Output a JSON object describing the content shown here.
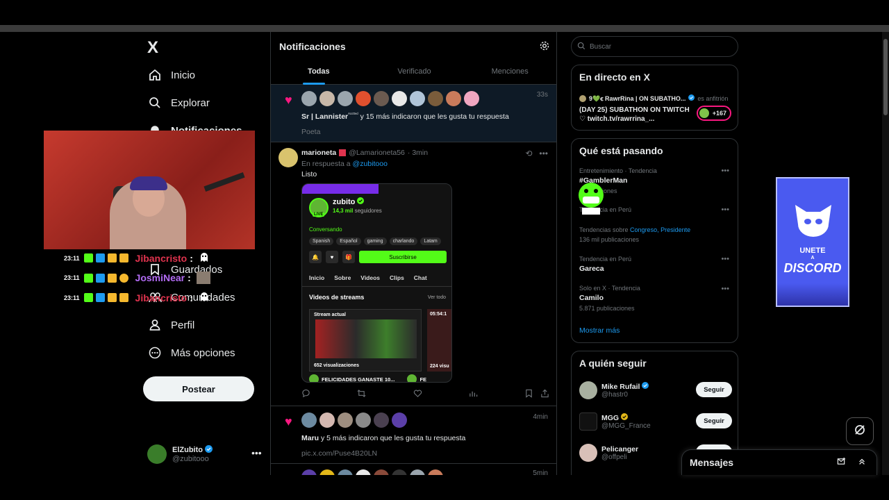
{
  "nav": {
    "logo": "X",
    "items": [
      {
        "label": "Inicio",
        "icon": "home-icon"
      },
      {
        "label": "Explorar",
        "icon": "search-icon"
      },
      {
        "label": "Notificaciones",
        "icon": "bell-icon"
      },
      {
        "label": "Guardados",
        "icon": "bookmark-icon"
      },
      {
        "label": "Comunidades",
        "icon": "people-icon"
      },
      {
        "label": "Perfil",
        "icon": "person-icon"
      },
      {
        "label": "Más opciones",
        "icon": "more-circle-icon"
      }
    ],
    "post_button": "Postear",
    "account": {
      "name": "ElZubito",
      "handle": "@zubitooo"
    }
  },
  "stream_chat": [
    {
      "time": "23:11",
      "user": "Jibancristo",
      "sep": ":",
      "color": "#e0334e"
    },
    {
      "time": "23:11",
      "user": "JosmiNear",
      "sep": ":",
      "color": "#b36cf5"
    },
    {
      "time": "23:11",
      "user": "Jibancristo",
      "sep": ":",
      "color": "#e0334e"
    }
  ],
  "center": {
    "title": "Notificaciones",
    "tabs": [
      "Todas",
      "Verificado",
      "Menciones"
    ],
    "notif1": {
      "time": "33s",
      "user": "Sr | Lannister",
      "user_suffix": "ᴬᶜᶜᴼᵉᵈ",
      "text": " y 15 más indicaron que les gusta tu respuesta",
      "sub": "Poeta"
    },
    "reply": {
      "name": "marioneta",
      "handle": "@Lamarioneta56",
      "time": "· 3min",
      "reply_prefix": "En respuesta a ",
      "reply_to": "@zubitooo",
      "body": "Listo"
    },
    "embed": {
      "name": "zubito",
      "followers": "14,3 mil",
      "followers_label": " seguidores",
      "live": "LIVE",
      "conv": "Conversando",
      "tags": [
        "Spanish",
        "Español",
        "gaming",
        "charlando",
        "Latam"
      ],
      "subscribe": "Suscribirse",
      "tabs": [
        "Inicio",
        "Sobre",
        "Videos",
        "Clips",
        "Chat"
      ],
      "videos_title": "Videos de streams",
      "ver_todo": "Ver todo",
      "thumb1_label": "Stream actual",
      "thumb1_views": "652 visualizaciones",
      "thumb2_label": "05:54:1",
      "thumb2_views": "224 visu",
      "footer1": "FELICIDADES GANASTE 10...",
      "footer2": "FE"
    },
    "notif2": {
      "time": "4min",
      "user": "Maru",
      "text": " y 5 más indicaron que les gusta tu respuesta",
      "sub": "pic.x.com/Puse4B20LN"
    },
    "notif3": {
      "time": "5min"
    }
  },
  "right": {
    "search_placeholder": "Buscar",
    "live": {
      "title": "En directo en X",
      "host": "9💚ꞓ RawrRina | ON SUBATHO...",
      "host_role": "es anfitrión",
      "stream_text": "(DAY 25) SUBATHON ON TWITCH ♡ twitch.tv/rawrrina_...",
      "count": "+167"
    },
    "trends": {
      "title": "Qué está pasando",
      "items": [
        {
          "cat": "Entretenimiento · Tendencia",
          "name": "#GamblerMan",
          "count": "publicaciones"
        },
        {
          "cat": "Tendencia en Perú",
          "name": "",
          "count": ""
        },
        {
          "cat": "Tendencias sobre ",
          "cat_links": "Congreso, Presidente",
          "name": "",
          "count": "136 mil publicaciones"
        },
        {
          "cat": "Tendencia en Perú",
          "name": "Gareca",
          "count": ""
        },
        {
          "cat": "Solo en X · Tendencia",
          "name": "Camilo",
          "count": "5.871 publicaciones"
        }
      ],
      "show_more": "Mostrar más"
    },
    "follow": {
      "title": "A quién seguir",
      "users": [
        {
          "name": "Mike Rufail",
          "handle": "@hastr0",
          "badge": "#1d9bf0",
          "button": "Seguir"
        },
        {
          "name": "MGG",
          "handle": "@MGG_France",
          "badge": "#e2b719",
          "button": "Seguir"
        },
        {
          "name": "Pelicanger",
          "handle": "@offpeli",
          "badge": "",
          "button": "Seguir"
        }
      ]
    }
  },
  "messages": {
    "title": "Mensajes"
  },
  "discord_ad": {
    "line1": "UNETE",
    "line2": "A",
    "line3": "DISCORD"
  },
  "colors": {
    "accent": "#1d9bf0",
    "like": "#f91880",
    "kick": "#53fc18",
    "discord": "#4a5af0"
  }
}
